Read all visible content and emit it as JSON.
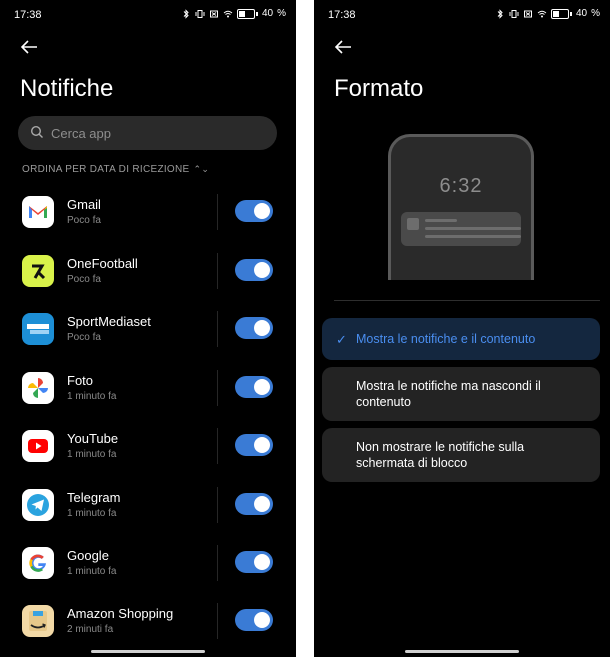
{
  "left": {
    "status": {
      "time": "17:38",
      "battery": "40"
    },
    "title": "Notifiche",
    "search": {
      "placeholder": "Cerca app"
    },
    "sort_label": "ORDINA PER DATA DI RICEZIONE",
    "apps": [
      {
        "name": "Gmail",
        "time": "Poco fa",
        "icon": "gmail-icon",
        "enabled": true
      },
      {
        "name": "OneFootball",
        "time": "Poco fa",
        "icon": "onefootball-icon",
        "enabled": true
      },
      {
        "name": "SportMediaset",
        "time": "Poco fa",
        "icon": "sportmediaset-icon",
        "enabled": true
      },
      {
        "name": "Foto",
        "time": "1 minuto fa",
        "icon": "photos-icon",
        "enabled": true
      },
      {
        "name": "YouTube",
        "time": "1 minuto fa",
        "icon": "youtube-icon",
        "enabled": true
      },
      {
        "name": "Telegram",
        "time": "1 minuto fa",
        "icon": "telegram-icon",
        "enabled": true
      },
      {
        "name": "Google",
        "time": "1 minuto fa",
        "icon": "google-icon",
        "enabled": true
      },
      {
        "name": "Amazon Shopping",
        "time": "2 minuti fa",
        "icon": "amazon-icon",
        "enabled": true
      }
    ]
  },
  "right": {
    "status": {
      "time": "17:38",
      "battery": "40"
    },
    "title": "Formato",
    "preview_clock": "6:32",
    "options": [
      {
        "label": "Mostra le notifiche e il contenuto",
        "selected": true
      },
      {
        "label": "Mostra le notifiche ma nascondi il contenuto",
        "selected": false
      },
      {
        "label": "Non mostrare le notifiche sulla schermata di blocco",
        "selected": false
      }
    ]
  },
  "colors": {
    "accent": "#3a7bd5",
    "background": "#000000"
  }
}
